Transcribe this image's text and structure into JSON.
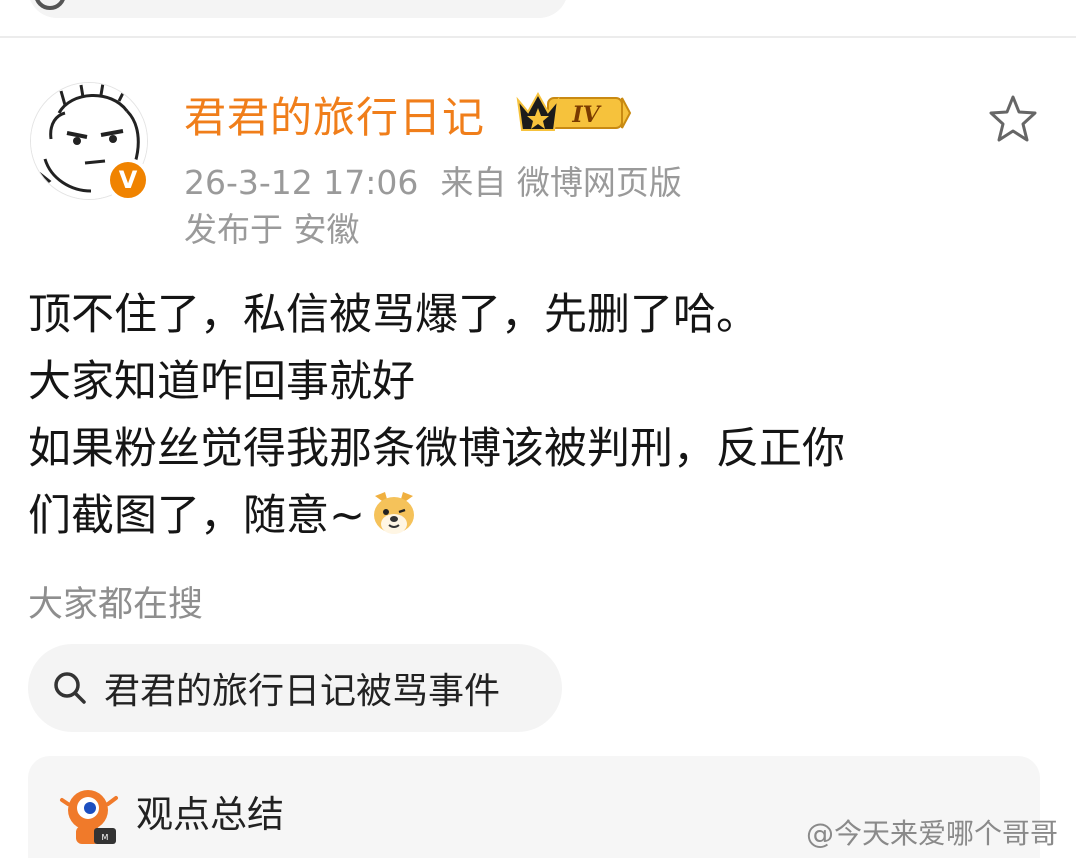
{
  "post": {
    "author": "君君的旅行日记",
    "author_badge": "IV",
    "timestamp": "26-3-12 17:06",
    "source": "来自 微博网页版",
    "location": "发布于 安徽",
    "body_lines": [
      "顶不住了，私信被骂爆了，先删了哈。",
      "大家知道咋回事就好",
      "如果粉丝觉得我那条微博该被判刑，反正你",
      "们截图了，随意~"
    ],
    "emoji": "dog-face-emoji",
    "favorite_icon": "star-outline-icon",
    "verify_mark": "V"
  },
  "search": {
    "hint": "大家都在搜",
    "chip_label": "君君的旅行日记被骂事件"
  },
  "summary": {
    "label": "观点总结"
  },
  "watermark": "@今天来爱哪个哥哥",
  "colors": {
    "username": "#f07e1a",
    "verify": "#f08300",
    "meta": "#9a9a9a",
    "chip_bg": "#f4f4f4"
  }
}
